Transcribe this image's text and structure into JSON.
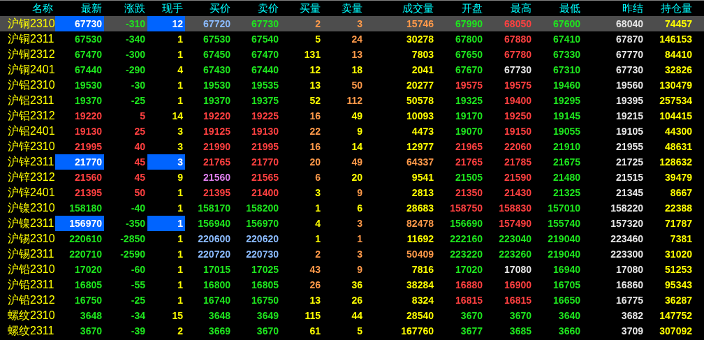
{
  "columns": [
    {
      "label": "名称"
    },
    {
      "label": "最新"
    },
    {
      "label": "涨跌"
    },
    {
      "label": "现手"
    },
    {
      "label": "买价"
    },
    {
      "label": "卖价"
    },
    {
      "label": "买量"
    },
    {
      "label": "卖量"
    },
    {
      "label": "成交量"
    },
    {
      "label": "开盘"
    },
    {
      "label": "最高"
    },
    {
      "label": "最低"
    },
    {
      "label": "昨结"
    },
    {
      "label": "持仓量"
    }
  ],
  "rows": [
    {
      "name": "沪铜2310",
      "selected": true,
      "flagged": true,
      "cells": [
        {
          "text": "67730",
          "color": "#ffffff"
        },
        {
          "text": "-310",
          "color": "#1ee61e"
        },
        {
          "text": "12",
          "color": "#ffffff"
        },
        {
          "text": "67720",
          "color": "#8cbcff"
        },
        {
          "text": "67730",
          "color": "#1ee61e"
        },
        {
          "text": "2",
          "color": "#ff9a4a"
        },
        {
          "text": "3",
          "color": "#ff9a4a"
        },
        {
          "text": "15746",
          "color": "#ff9a4a"
        },
        {
          "text": "67990",
          "color": "#1ee61e"
        },
        {
          "text": "68050",
          "color": "#ff4040"
        },
        {
          "text": "67600",
          "color": "#1ee61e"
        },
        {
          "text": "68040",
          "color": "#e6e6e6"
        },
        {
          "text": "74457",
          "color": "#ffff00"
        }
      ]
    },
    {
      "name": "沪铜2311",
      "selected": false,
      "flagged": false,
      "cells": [
        {
          "text": "67530",
          "color": "#1ee61e"
        },
        {
          "text": "-340",
          "color": "#1ee61e"
        },
        {
          "text": "1",
          "color": "#ffff00"
        },
        {
          "text": "67530",
          "color": "#1ee61e"
        },
        {
          "text": "67540",
          "color": "#1ee61e"
        },
        {
          "text": "5",
          "color": "#ffff00"
        },
        {
          "text": "24",
          "color": "#ff9a4a"
        },
        {
          "text": "30278",
          "color": "#ffff00"
        },
        {
          "text": "67800",
          "color": "#1ee61e"
        },
        {
          "text": "67880",
          "color": "#ff4040"
        },
        {
          "text": "67410",
          "color": "#1ee61e"
        },
        {
          "text": "67870",
          "color": "#e6e6e6"
        },
        {
          "text": "146153",
          "color": "#ffff00"
        }
      ]
    },
    {
      "name": "沪铜2312",
      "selected": false,
      "flagged": false,
      "cells": [
        {
          "text": "67470",
          "color": "#1ee61e"
        },
        {
          "text": "-300",
          "color": "#1ee61e"
        },
        {
          "text": "1",
          "color": "#ffff00"
        },
        {
          "text": "67450",
          "color": "#1ee61e"
        },
        {
          "text": "67470",
          "color": "#1ee61e"
        },
        {
          "text": "131",
          "color": "#ffff00"
        },
        {
          "text": "13",
          "color": "#ff9a4a"
        },
        {
          "text": "7803",
          "color": "#ffff00"
        },
        {
          "text": "67650",
          "color": "#1ee61e"
        },
        {
          "text": "67780",
          "color": "#ff4040"
        },
        {
          "text": "67330",
          "color": "#1ee61e"
        },
        {
          "text": "67770",
          "color": "#e6e6e6"
        },
        {
          "text": "84410",
          "color": "#ffff00"
        }
      ]
    },
    {
      "name": "沪铜2401",
      "selected": false,
      "flagged": false,
      "cells": [
        {
          "text": "67440",
          "color": "#1ee61e"
        },
        {
          "text": "-290",
          "color": "#1ee61e"
        },
        {
          "text": "4",
          "color": "#ffff00"
        },
        {
          "text": "67430",
          "color": "#1ee61e"
        },
        {
          "text": "67440",
          "color": "#1ee61e"
        },
        {
          "text": "12",
          "color": "#ffff00"
        },
        {
          "text": "18",
          "color": "#ffff00"
        },
        {
          "text": "2041",
          "color": "#ffff00"
        },
        {
          "text": "67670",
          "color": "#1ee61e"
        },
        {
          "text": "67730",
          "color": "#e6e6e6"
        },
        {
          "text": "67310",
          "color": "#1ee61e"
        },
        {
          "text": "67730",
          "color": "#e6e6e6"
        },
        {
          "text": "32826",
          "color": "#ffff00"
        }
      ]
    },
    {
      "name": "沪铝2310",
      "selected": false,
      "flagged": false,
      "cells": [
        {
          "text": "19530",
          "color": "#1ee61e"
        },
        {
          "text": "-30",
          "color": "#1ee61e"
        },
        {
          "text": "1",
          "color": "#ffff00"
        },
        {
          "text": "19530",
          "color": "#1ee61e"
        },
        {
          "text": "19535",
          "color": "#1ee61e"
        },
        {
          "text": "13",
          "color": "#ffff00"
        },
        {
          "text": "50",
          "color": "#ff9a4a"
        },
        {
          "text": "20277",
          "color": "#ffff00"
        },
        {
          "text": "19575",
          "color": "#ff4040"
        },
        {
          "text": "19575",
          "color": "#ff4040"
        },
        {
          "text": "19460",
          "color": "#1ee61e"
        },
        {
          "text": "19560",
          "color": "#e6e6e6"
        },
        {
          "text": "130479",
          "color": "#ffff00"
        }
      ]
    },
    {
      "name": "沪铝2311",
      "selected": false,
      "flagged": false,
      "cells": [
        {
          "text": "19370",
          "color": "#1ee61e"
        },
        {
          "text": "-25",
          "color": "#1ee61e"
        },
        {
          "text": "1",
          "color": "#ffff00"
        },
        {
          "text": "19370",
          "color": "#1ee61e"
        },
        {
          "text": "19375",
          "color": "#1ee61e"
        },
        {
          "text": "52",
          "color": "#ffff00"
        },
        {
          "text": "112",
          "color": "#ff9a4a"
        },
        {
          "text": "50578",
          "color": "#ffff00"
        },
        {
          "text": "19325",
          "color": "#1ee61e"
        },
        {
          "text": "19400",
          "color": "#ff4040"
        },
        {
          "text": "19295",
          "color": "#1ee61e"
        },
        {
          "text": "19395",
          "color": "#e6e6e6"
        },
        {
          "text": "257534",
          "color": "#ffff00"
        }
      ]
    },
    {
      "name": "沪铝2312",
      "selected": false,
      "flagged": false,
      "cells": [
        {
          "text": "19220",
          "color": "#ff4040"
        },
        {
          "text": "5",
          "color": "#ff4040"
        },
        {
          "text": "14",
          "color": "#ffff00"
        },
        {
          "text": "19220",
          "color": "#ff4040"
        },
        {
          "text": "19225",
          "color": "#ff4040"
        },
        {
          "text": "16",
          "color": "#ff9a4a"
        },
        {
          "text": "49",
          "color": "#ffff00"
        },
        {
          "text": "10093",
          "color": "#ffff00"
        },
        {
          "text": "19170",
          "color": "#1ee61e"
        },
        {
          "text": "19250",
          "color": "#ff4040"
        },
        {
          "text": "19145",
          "color": "#1ee61e"
        },
        {
          "text": "19215",
          "color": "#e6e6e6"
        },
        {
          "text": "104415",
          "color": "#ffff00"
        }
      ]
    },
    {
      "name": "沪铝2401",
      "selected": false,
      "flagged": false,
      "cells": [
        {
          "text": "19130",
          "color": "#ff4040"
        },
        {
          "text": "25",
          "color": "#ff4040"
        },
        {
          "text": "3",
          "color": "#ffff00"
        },
        {
          "text": "19125",
          "color": "#ff4040"
        },
        {
          "text": "19130",
          "color": "#ff4040"
        },
        {
          "text": "22",
          "color": "#ff9a4a"
        },
        {
          "text": "9",
          "color": "#ffff00"
        },
        {
          "text": "4473",
          "color": "#ffff00"
        },
        {
          "text": "19070",
          "color": "#1ee61e"
        },
        {
          "text": "19150",
          "color": "#ff4040"
        },
        {
          "text": "19055",
          "color": "#1ee61e"
        },
        {
          "text": "19105",
          "color": "#e6e6e6"
        },
        {
          "text": "44300",
          "color": "#ffff00"
        }
      ]
    },
    {
      "name": "沪锌2310",
      "selected": false,
      "flagged": false,
      "cells": [
        {
          "text": "21995",
          "color": "#ff4040"
        },
        {
          "text": "40",
          "color": "#ff4040"
        },
        {
          "text": "3",
          "color": "#ffff00"
        },
        {
          "text": "21990",
          "color": "#ff4040"
        },
        {
          "text": "21995",
          "color": "#ff4040"
        },
        {
          "text": "16",
          "color": "#ff9a4a"
        },
        {
          "text": "14",
          "color": "#ffff00"
        },
        {
          "text": "12977",
          "color": "#ffff00"
        },
        {
          "text": "21965",
          "color": "#ff4040"
        },
        {
          "text": "22060",
          "color": "#ff4040"
        },
        {
          "text": "21910",
          "color": "#1ee61e"
        },
        {
          "text": "21955",
          "color": "#e6e6e6"
        },
        {
          "text": "48631",
          "color": "#ffff00"
        }
      ]
    },
    {
      "name": "沪锌2311",
      "selected": false,
      "flagged": true,
      "cells": [
        {
          "text": "21770",
          "color": "#ffffff"
        },
        {
          "text": "45",
          "color": "#ff4040"
        },
        {
          "text": "3",
          "color": "#ffffff"
        },
        {
          "text": "21765",
          "color": "#ff4040"
        },
        {
          "text": "21770",
          "color": "#ff4040"
        },
        {
          "text": "20",
          "color": "#ff9a4a"
        },
        {
          "text": "49",
          "color": "#ff9a4a"
        },
        {
          "text": "64337",
          "color": "#ff9a4a"
        },
        {
          "text": "21765",
          "color": "#ff4040"
        },
        {
          "text": "21785",
          "color": "#ff4040"
        },
        {
          "text": "21675",
          "color": "#1ee61e"
        },
        {
          "text": "21725",
          "color": "#e6e6e6"
        },
        {
          "text": "128632",
          "color": "#ffff00"
        }
      ]
    },
    {
      "name": "沪锌2312",
      "selected": false,
      "flagged": false,
      "cells": [
        {
          "text": "21560",
          "color": "#ff4040"
        },
        {
          "text": "45",
          "color": "#ff4040"
        },
        {
          "text": "9",
          "color": "#ffff00"
        },
        {
          "text": "21560",
          "color": "#e080f0"
        },
        {
          "text": "21565",
          "color": "#ff4040"
        },
        {
          "text": "6",
          "color": "#ff9a4a"
        },
        {
          "text": "20",
          "color": "#ffff00"
        },
        {
          "text": "9541",
          "color": "#ffff00"
        },
        {
          "text": "21505",
          "color": "#1ee61e"
        },
        {
          "text": "21590",
          "color": "#ff4040"
        },
        {
          "text": "21480",
          "color": "#1ee61e"
        },
        {
          "text": "21515",
          "color": "#e6e6e6"
        },
        {
          "text": "39479",
          "color": "#ffff00"
        }
      ]
    },
    {
      "name": "沪锌2401",
      "selected": false,
      "flagged": false,
      "cells": [
        {
          "text": "21395",
          "color": "#ff4040"
        },
        {
          "text": "50",
          "color": "#ff4040"
        },
        {
          "text": "1",
          "color": "#ffff00"
        },
        {
          "text": "21395",
          "color": "#ff4040"
        },
        {
          "text": "21400",
          "color": "#ff4040"
        },
        {
          "text": "3",
          "color": "#ffff00"
        },
        {
          "text": "9",
          "color": "#ff9a4a"
        },
        {
          "text": "2813",
          "color": "#ffff00"
        },
        {
          "text": "21350",
          "color": "#ff4040"
        },
        {
          "text": "21430",
          "color": "#ff4040"
        },
        {
          "text": "21325",
          "color": "#1ee61e"
        },
        {
          "text": "21345",
          "color": "#e6e6e6"
        },
        {
          "text": "8667",
          "color": "#ffff00"
        }
      ]
    },
    {
      "name": "沪镍2310",
      "selected": false,
      "flagged": false,
      "cells": [
        {
          "text": "158180",
          "color": "#1ee61e"
        },
        {
          "text": "-40",
          "color": "#1ee61e"
        },
        {
          "text": "1",
          "color": "#ffff00"
        },
        {
          "text": "158170",
          "color": "#1ee61e"
        },
        {
          "text": "158200",
          "color": "#1ee61e"
        },
        {
          "text": "1",
          "color": "#ffff00"
        },
        {
          "text": "6",
          "color": "#ffff00"
        },
        {
          "text": "28683",
          "color": "#ffff00"
        },
        {
          "text": "158750",
          "color": "#ff4040"
        },
        {
          "text": "158830",
          "color": "#ff4040"
        },
        {
          "text": "157010",
          "color": "#1ee61e"
        },
        {
          "text": "158220",
          "color": "#e6e6e6"
        },
        {
          "text": "22388",
          "color": "#ffff00"
        }
      ]
    },
    {
      "name": "沪镍2311",
      "selected": false,
      "flagged": true,
      "cells": [
        {
          "text": "156970",
          "color": "#ffffff"
        },
        {
          "text": "-350",
          "color": "#1ee61e"
        },
        {
          "text": "1",
          "color": "#ffffff"
        },
        {
          "text": "156940",
          "color": "#1ee61e"
        },
        {
          "text": "156970",
          "color": "#1ee61e"
        },
        {
          "text": "4",
          "color": "#ffff00"
        },
        {
          "text": "3",
          "color": "#ff9a4a"
        },
        {
          "text": "82478",
          "color": "#ff9a4a"
        },
        {
          "text": "156690",
          "color": "#1ee61e"
        },
        {
          "text": "157490",
          "color": "#ff4040"
        },
        {
          "text": "155740",
          "color": "#1ee61e"
        },
        {
          "text": "157320",
          "color": "#e6e6e6"
        },
        {
          "text": "71787",
          "color": "#ffff00"
        }
      ]
    },
    {
      "name": "沪锡2310",
      "selected": false,
      "flagged": false,
      "cells": [
        {
          "text": "220610",
          "color": "#1ee61e"
        },
        {
          "text": "-2850",
          "color": "#1ee61e"
        },
        {
          "text": "1",
          "color": "#ffff00"
        },
        {
          "text": "220600",
          "color": "#8cbcff"
        },
        {
          "text": "220620",
          "color": "#8cbcff"
        },
        {
          "text": "1",
          "color": "#ffff00"
        },
        {
          "text": "1",
          "color": "#ff9a4a"
        },
        {
          "text": "11692",
          "color": "#ffff00"
        },
        {
          "text": "222160",
          "color": "#1ee61e"
        },
        {
          "text": "223040",
          "color": "#1ee61e"
        },
        {
          "text": "219040",
          "color": "#1ee61e"
        },
        {
          "text": "223460",
          "color": "#e6e6e6"
        },
        {
          "text": "7381",
          "color": "#ffff00"
        }
      ]
    },
    {
      "name": "沪锡2311",
      "selected": false,
      "flagged": false,
      "cells": [
        {
          "text": "220710",
          "color": "#1ee61e"
        },
        {
          "text": "-2590",
          "color": "#1ee61e"
        },
        {
          "text": "1",
          "color": "#ffff00"
        },
        {
          "text": "220720",
          "color": "#8cbcff"
        },
        {
          "text": "220730",
          "color": "#8cbcff"
        },
        {
          "text": "2",
          "color": "#ff9a4a"
        },
        {
          "text": "3",
          "color": "#ff9a4a"
        },
        {
          "text": "50409",
          "color": "#ff9a4a"
        },
        {
          "text": "223220",
          "color": "#1ee61e"
        },
        {
          "text": "223260",
          "color": "#1ee61e"
        },
        {
          "text": "219040",
          "color": "#1ee61e"
        },
        {
          "text": "223300",
          "color": "#e6e6e6"
        },
        {
          "text": "31020",
          "color": "#ffff00"
        }
      ]
    },
    {
      "name": "沪铅2310",
      "selected": false,
      "flagged": false,
      "cells": [
        {
          "text": "17020",
          "color": "#1ee61e"
        },
        {
          "text": "-60",
          "color": "#1ee61e"
        },
        {
          "text": "1",
          "color": "#ffff00"
        },
        {
          "text": "17015",
          "color": "#1ee61e"
        },
        {
          "text": "17025",
          "color": "#1ee61e"
        },
        {
          "text": "43",
          "color": "#ff9a4a"
        },
        {
          "text": "9",
          "color": "#ff9a4a"
        },
        {
          "text": "7816",
          "color": "#ffff00"
        },
        {
          "text": "17020",
          "color": "#1ee61e"
        },
        {
          "text": "17080",
          "color": "#e6e6e6"
        },
        {
          "text": "16940",
          "color": "#1ee61e"
        },
        {
          "text": "17080",
          "color": "#e6e6e6"
        },
        {
          "text": "51253",
          "color": "#ffff00"
        }
      ]
    },
    {
      "name": "沪铅2311",
      "selected": false,
      "flagged": false,
      "cells": [
        {
          "text": "16805",
          "color": "#1ee61e"
        },
        {
          "text": "-55",
          "color": "#1ee61e"
        },
        {
          "text": "1",
          "color": "#ffff00"
        },
        {
          "text": "16800",
          "color": "#1ee61e"
        },
        {
          "text": "16805",
          "color": "#1ee61e"
        },
        {
          "text": "26",
          "color": "#ff9a4a"
        },
        {
          "text": "36",
          "color": "#ffff00"
        },
        {
          "text": "38284",
          "color": "#ffff00"
        },
        {
          "text": "16880",
          "color": "#ff4040"
        },
        {
          "text": "16900",
          "color": "#ff4040"
        },
        {
          "text": "16705",
          "color": "#1ee61e"
        },
        {
          "text": "16860",
          "color": "#e6e6e6"
        },
        {
          "text": "95343",
          "color": "#ffff00"
        }
      ]
    },
    {
      "name": "沪铅2312",
      "selected": false,
      "flagged": false,
      "cells": [
        {
          "text": "16750",
          "color": "#1ee61e"
        },
        {
          "text": "-25",
          "color": "#1ee61e"
        },
        {
          "text": "1",
          "color": "#ffff00"
        },
        {
          "text": "16740",
          "color": "#1ee61e"
        },
        {
          "text": "16750",
          "color": "#1ee61e"
        },
        {
          "text": "13",
          "color": "#ffff00"
        },
        {
          "text": "26",
          "color": "#ffff00"
        },
        {
          "text": "8324",
          "color": "#ffff00"
        },
        {
          "text": "16815",
          "color": "#ff4040"
        },
        {
          "text": "16815",
          "color": "#ff4040"
        },
        {
          "text": "16650",
          "color": "#1ee61e"
        },
        {
          "text": "16775",
          "color": "#e6e6e6"
        },
        {
          "text": "36287",
          "color": "#ffff00"
        }
      ]
    },
    {
      "name": "螺纹2310",
      "selected": false,
      "flagged": false,
      "cells": [
        {
          "text": "3648",
          "color": "#1ee61e"
        },
        {
          "text": "-34",
          "color": "#1ee61e"
        },
        {
          "text": "15",
          "color": "#ffff00"
        },
        {
          "text": "3648",
          "color": "#1ee61e"
        },
        {
          "text": "3649",
          "color": "#1ee61e"
        },
        {
          "text": "115",
          "color": "#ffff00"
        },
        {
          "text": "44",
          "color": "#ffff00"
        },
        {
          "text": "28540",
          "color": "#ffff00"
        },
        {
          "text": "3670",
          "color": "#1ee61e"
        },
        {
          "text": "3670",
          "color": "#1ee61e"
        },
        {
          "text": "3640",
          "color": "#1ee61e"
        },
        {
          "text": "3682",
          "color": "#e6e6e6"
        },
        {
          "text": "147752",
          "color": "#ffff00"
        }
      ]
    },
    {
      "name": "螺纹2311",
      "selected": false,
      "flagged": false,
      "cells": [
        {
          "text": "3670",
          "color": "#1ee61e"
        },
        {
          "text": "-39",
          "color": "#1ee61e"
        },
        {
          "text": "2",
          "color": "#ffff00"
        },
        {
          "text": "3669",
          "color": "#1ee61e"
        },
        {
          "text": "3670",
          "color": "#1ee61e"
        },
        {
          "text": "61",
          "color": "#ffff00"
        },
        {
          "text": "5",
          "color": "#ffff00"
        },
        {
          "text": "167760",
          "color": "#ffff00"
        },
        {
          "text": "3677",
          "color": "#1ee61e"
        },
        {
          "text": "3685",
          "color": "#1ee61e"
        },
        {
          "text": "3660",
          "color": "#1ee61e"
        },
        {
          "text": "3709",
          "color": "#e6e6e6"
        },
        {
          "text": "307092",
          "color": "#ffff00"
        }
      ]
    }
  ]
}
